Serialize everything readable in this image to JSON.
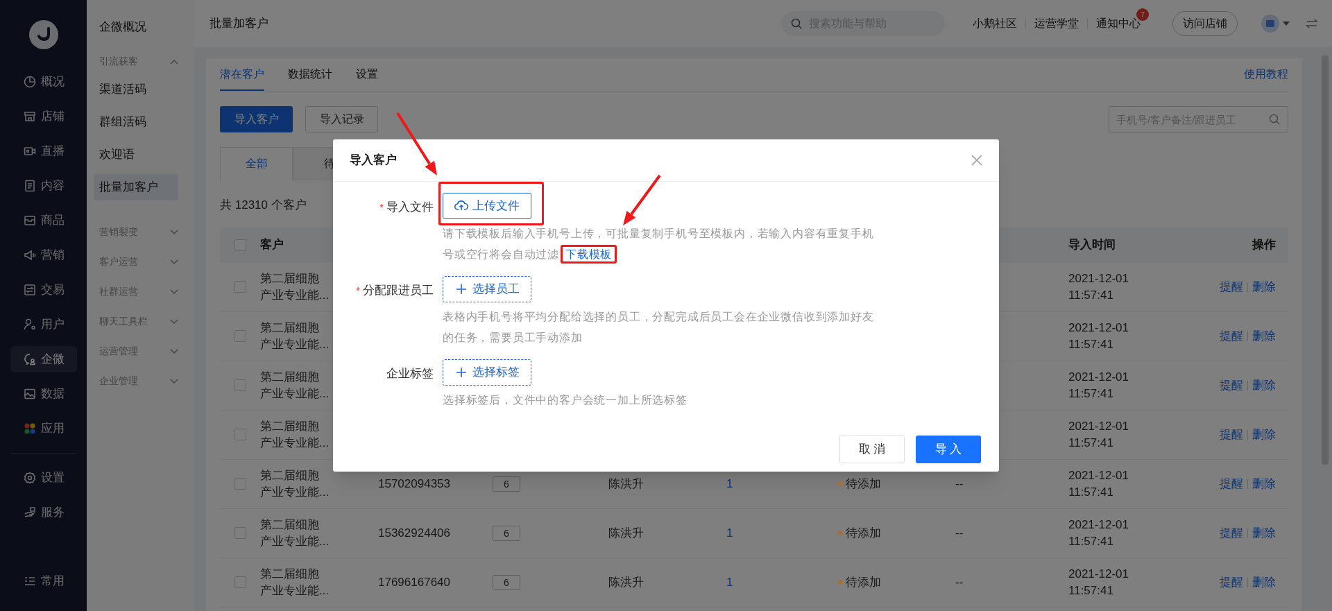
{
  "sidebar": {
    "items": [
      {
        "label": "概况",
        "selected": false
      },
      {
        "label": "店铺",
        "selected": false
      },
      {
        "label": "直播",
        "selected": false
      },
      {
        "label": "内容",
        "selected": false
      },
      {
        "label": "商品",
        "selected": false
      },
      {
        "label": "营销",
        "selected": false
      },
      {
        "label": "交易",
        "selected": false
      },
      {
        "label": "用户",
        "selected": false
      },
      {
        "label": "企微",
        "selected": true
      },
      {
        "label": "数据",
        "selected": false
      },
      {
        "label": "应用",
        "selected": false
      }
    ],
    "bottom_items": [
      {
        "label": "设置",
        "selected": false
      },
      {
        "label": "服务",
        "selected": false
      }
    ],
    "footer": "常用"
  },
  "subnav": [
    {
      "kind": "link",
      "label": "企微概况",
      "selected": false
    },
    {
      "kind": "group",
      "label": "引流获客",
      "expanded": true,
      "children": [
        {
          "kind": "link",
          "label": "渠道活码",
          "selected": false
        },
        {
          "kind": "link",
          "label": "群组活码",
          "selected": false
        },
        {
          "kind": "link",
          "label": "欢迎语",
          "selected": false
        },
        {
          "kind": "link",
          "label": "批量加客户",
          "selected": true
        }
      ]
    },
    {
      "kind": "group",
      "label": "营销裂变",
      "expanded": false
    },
    {
      "kind": "group",
      "label": "客户运营",
      "expanded": false
    },
    {
      "kind": "group",
      "label": "社群运营",
      "expanded": false
    },
    {
      "kind": "group",
      "label": "聊天工具栏",
      "expanded": false
    },
    {
      "kind": "group",
      "label": "运营管理",
      "expanded": false
    },
    {
      "kind": "group",
      "label": "企业管理",
      "expanded": false
    }
  ],
  "topbar": {
    "title": "批量加客户",
    "search": {
      "placeholder": "搜索功能与帮助"
    },
    "links": [
      {
        "label": "小鹅社区"
      },
      {
        "label": "运营学堂"
      },
      {
        "label": "通知中心",
        "badge": "7"
      }
    ],
    "visit_button": "访问店铺"
  },
  "tabs": [
    {
      "label": "潜在客户",
      "selected": true
    },
    {
      "label": "数据统计",
      "selected": false
    },
    {
      "label": "设置",
      "selected": false
    }
  ],
  "help_link": "使用教程",
  "actions": [
    {
      "label": "导入客户",
      "kind": "primary"
    },
    {
      "label": "导入记录",
      "kind": "secondary"
    }
  ],
  "table_search": {
    "placeholder": "手机号/客户备注/跟进员工"
  },
  "filter_tabs": [
    {
      "label": "全部",
      "selected": true
    },
    {
      "label": "待",
      "selected": false
    }
  ],
  "count_text": "共 12310 个客户",
  "table": {
    "select_all": {
      "checked": false
    },
    "columns": [
      {
        "label": "客户"
      },
      {
        "label": "导入时间"
      },
      {
        "label": "操作"
      }
    ],
    "rows": [
      {
        "checked": false,
        "customer": "第二届细胞产业专业能...",
        "time": "2021-12-01 11:57:41",
        "actions": [
          "提醒",
          "删除"
        ]
      },
      {
        "checked": false,
        "customer": "第二届细胞产业专业能...",
        "time": "2021-12-01 11:57:41",
        "actions": [
          "提醒",
          "删除"
        ]
      },
      {
        "checked": false,
        "customer": "第二届细胞产业专业能...",
        "time": "2021-12-01 11:57:41",
        "actions": [
          "提醒",
          "删除"
        ]
      },
      {
        "checked": false,
        "customer": "第二届细胞产业专业能...",
        "time": "2021-12-01 11:57:41",
        "actions": [
          "提醒",
          "删除"
        ]
      },
      {
        "checked": false,
        "customer": "第二届细胞产业专业能...",
        "phone": "15702094353",
        "tag_count": "6",
        "staff": "陈洪升",
        "count": "1",
        "status": {
          "label": "待添加",
          "color": "#a3703a"
        },
        "remark": "--",
        "time": "2021-12-01 11:57:41",
        "actions": [
          "提醒",
          "删除"
        ]
      },
      {
        "checked": false,
        "customer": "第二届细胞产业专业能...",
        "phone": "15362924406",
        "tag_count": "6",
        "staff": "陈洪升",
        "count": "1",
        "status": {
          "label": "待添加",
          "color": "#a3703a"
        },
        "remark": "--",
        "time": "2021-12-01 11:57:41",
        "actions": [
          "提醒",
          "删除"
        ]
      },
      {
        "checked": false,
        "customer": "第二届细胞产业专业能...",
        "phone": "17696167640",
        "tag_count": "6",
        "staff": "陈洪升",
        "count": "1",
        "status": {
          "label": "待添加",
          "color": "#a3703a"
        },
        "remark": "--",
        "time": "2021-12-01 11:57:41",
        "actions": [
          "提醒",
          "删除"
        ]
      }
    ]
  },
  "dialog": {
    "title": "导入客户",
    "required_symbol": "*",
    "fields": [
      {
        "kind": "upload",
        "label": "导入文件",
        "required": true,
        "button": "上传文件",
        "help": "请下载模板后输入手机号上传，可批量复制手机号至模板内，若输入内容有重复手机号或空行将会自动过滤",
        "link": "下载模板"
      },
      {
        "kind": "select",
        "label": "分配跟进员工",
        "required": true,
        "button": "选择员工",
        "help": "表格内手机号将平均分配给选择的员工，分配完成后员工会在企业微信收到添加好友的任务，需要员工手动添加"
      },
      {
        "kind": "select",
        "label": "企业标签",
        "required": false,
        "button": "选择标签",
        "help": "选择标签后，文件中的客户会统一加上所选标签"
      }
    ],
    "buttons": [
      {
        "label": "取 消",
        "kind": "secondary"
      },
      {
        "label": "导 入",
        "kind": "primary"
      }
    ]
  }
}
